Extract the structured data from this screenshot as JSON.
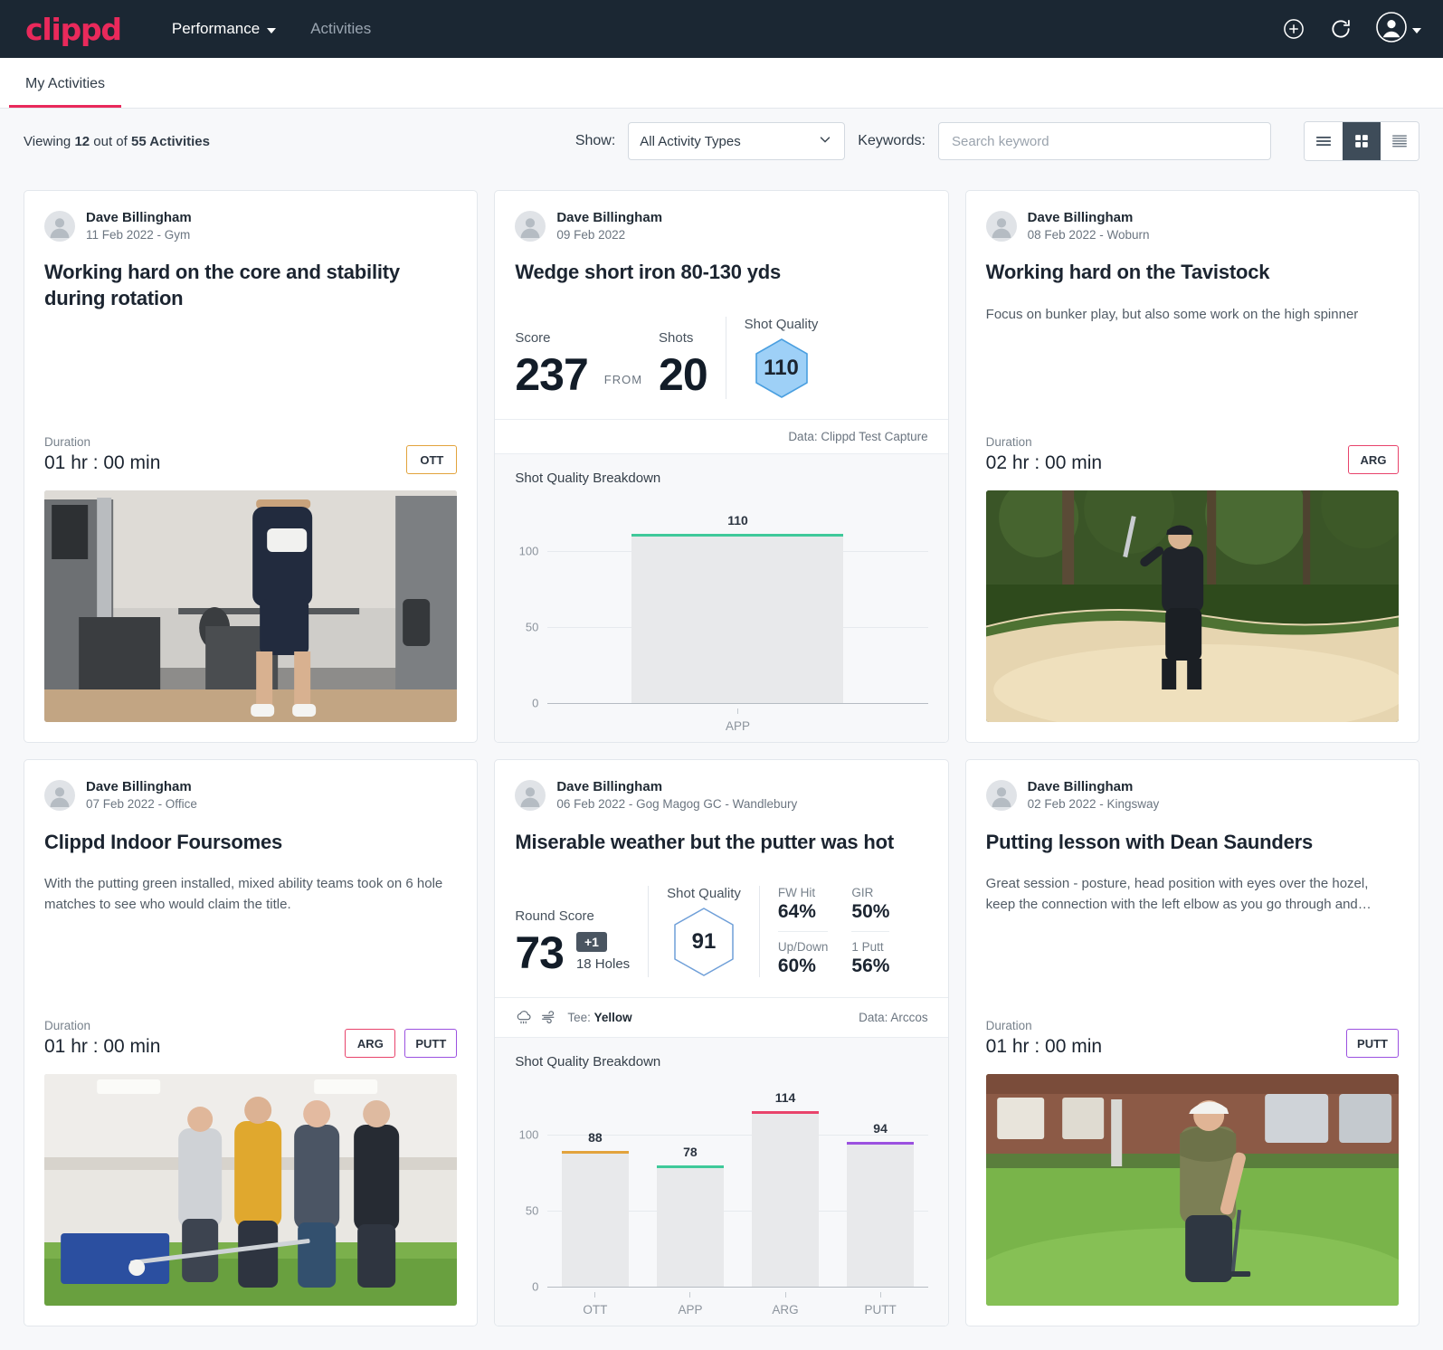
{
  "brand": {
    "logo_text": "clippd",
    "accent": "#e9295b"
  },
  "topnav": {
    "items": [
      {
        "label": "Performance",
        "icon": "chevron-down-icon"
      },
      {
        "label": "Activities"
      }
    ],
    "icons": [
      "add-circle-icon",
      "refresh-icon",
      "account-avatar-icon",
      "chevron-down-icon"
    ]
  },
  "tabs": [
    {
      "label": "My Activities"
    }
  ],
  "filterbar": {
    "viewing_prefix": "Viewing ",
    "viewing_count": "12",
    "viewing_middle": " out of ",
    "viewing_total": "55 Activities",
    "show_label": "Show:",
    "show_value": "All Activity Types",
    "keywords_label": "Keywords:",
    "search_placeholder": "Search keyword",
    "view_modes": [
      "list-view-icon",
      "grid-view-icon",
      "compact-view-icon"
    ],
    "active_view": "grid-view-icon"
  },
  "tag_colors": {
    "OTT": "#e2a33c",
    "APP": "#3fc99a",
    "ARG": "#e8436b",
    "PUTT": "#9b51e0"
  },
  "cards": [
    {
      "author": "Dave Billingham",
      "meta": "11 Feb 2022 - Gym",
      "title": "Working hard on the core and stability during rotation",
      "description": "",
      "duration_label": "Duration",
      "duration_value": "01 hr : 00 min",
      "tags": [
        "OTT"
      ],
      "image": "gym-rotation-photo"
    },
    {
      "author": "Dave Billingham",
      "meta": "09 Feb 2022",
      "title": "Wedge short iron 80-130 yds",
      "stats": {
        "score_label": "Score",
        "score_value": "237",
        "from_label": "FROM",
        "shots_label": "Shots",
        "shots_value": "20",
        "quality_label": "Shot Quality",
        "quality_value": "110"
      },
      "data_source": "Data: Clippd Test Capture",
      "chart_title": "Shot Quality Breakdown"
    },
    {
      "author": "Dave Billingham",
      "meta": "08 Feb 2022 - Woburn",
      "title": "Working hard on the Tavistock",
      "description": "Focus on bunker play, but also some work on the high spinner",
      "duration_label": "Duration",
      "duration_value": "02 hr : 00 min",
      "tags": [
        "ARG"
      ],
      "image": "bunker-play-photo"
    },
    {
      "author": "Dave Billingham",
      "meta": "07 Feb 2022 - Office",
      "title": "Clippd Indoor Foursomes",
      "description": "With the putting green installed, mixed ability teams took on 6 hole matches to see who would claim the title.",
      "duration_label": "Duration",
      "duration_value": "01 hr : 00 min",
      "tags": [
        "ARG",
        "PUTT"
      ],
      "image": "indoor-foursomes-group-photo"
    },
    {
      "author": "Dave Billingham",
      "meta": "06 Feb 2022 - Gog Magog GC - Wandlebury",
      "title": "Miserable weather but the putter was hot",
      "stats": {
        "round_label": "Round Score",
        "round_value": "73",
        "plus_badge": "+1",
        "holes_label": "18 Holes",
        "quality_label": "Shot Quality",
        "quality_value": "91",
        "pcts": [
          {
            "label": "FW Hit",
            "value": "64%"
          },
          {
            "label": "GIR",
            "value": "50%"
          },
          {
            "label": "Up/Down",
            "value": "60%"
          },
          {
            "label": "1 Putt",
            "value": "56%"
          }
        ]
      },
      "tee_prefix": "Tee: ",
      "tee_value": "Yellow",
      "weather_icons": [
        "rain-cloud-icon",
        "wind-icon"
      ],
      "data_source": "Data: Arccos",
      "chart_title": "Shot Quality Breakdown"
    },
    {
      "author": "Dave Billingham",
      "meta": "02 Feb 2022 - Kingsway",
      "title": "Putting lesson with Dean Saunders",
      "description": "Great session - posture, head position with eyes over the hozel, keep the connection with the left elbow as you go through and…",
      "duration_label": "Duration",
      "duration_value": "01 hr : 00 min",
      "tags": [
        "PUTT"
      ],
      "image": "putting-lesson-photo"
    }
  ],
  "chart_data": [
    {
      "type": "bar",
      "title": "Shot Quality Breakdown",
      "categories": [
        "APP"
      ],
      "values": [
        110
      ],
      "bar_colors": [
        "#3fc99a"
      ],
      "ylabel": "",
      "xlabel": "",
      "ylim": [
        0,
        130
      ],
      "yticks": [
        0,
        50,
        100
      ],
      "grid": true,
      "legend": "none"
    },
    {
      "type": "bar",
      "title": "Shot Quality Breakdown",
      "categories": [
        "OTT",
        "APP",
        "ARG",
        "PUTT"
      ],
      "values": [
        88,
        78,
        114,
        94
      ],
      "bar_colors": [
        "#e2a33c",
        "#3fc99a",
        "#e8436b",
        "#9b51e0"
      ],
      "ylabel": "",
      "xlabel": "",
      "ylim": [
        0,
        130
      ],
      "yticks": [
        0,
        50,
        100
      ],
      "grid": true,
      "legend": "none"
    }
  ]
}
